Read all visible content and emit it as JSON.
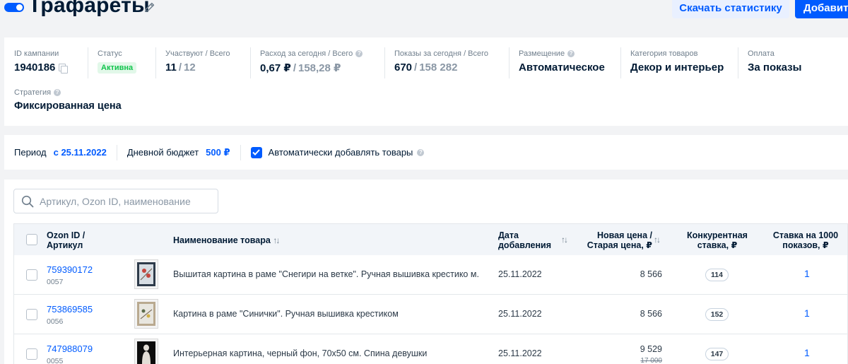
{
  "header": {
    "title": "Трафареты",
    "download_stats_label": "Скачать статистику",
    "add_label": "Добавить"
  },
  "info": {
    "campaign_id_label": "ID кампании",
    "campaign_id": "1940186",
    "status_label": "Статус",
    "status_value": "Активна",
    "participants_label": "Участвуют / Всего",
    "participants_now": "11",
    "participants_total": "12",
    "spend_label": "Расход за сегодня / Всего",
    "spend_today": "0,67 ₽",
    "spend_total": "158,28 ₽",
    "views_label": "Показы за сегодня / Всего",
    "views_today": "670",
    "views_total": "158 282",
    "placement_label": "Размещение",
    "placement_value": "Автоматическое",
    "category_label": "Категория товаров",
    "category_value": "Декор и интерьер",
    "payment_label": "Оплата",
    "payment_value": "За показы",
    "strategy_label": "Стратегия",
    "strategy_value": "Фиксированная цена",
    "separator": "/"
  },
  "period": {
    "period_label": "Период",
    "period_value": "с 25.11.2022",
    "budget_label": "Дневной бюджет",
    "budget_value": "500 ₽",
    "auto_add_label": "Автоматически добавлять товары"
  },
  "search": {
    "placeholder": "Артикул, Ozon ID, наименование"
  },
  "table": {
    "col_id_line1": "Ozon ID /",
    "col_id_line2": "Артикул",
    "col_name": "Наименование товара",
    "col_date_line1": "Дата",
    "col_date_line2": "добавления",
    "col_price_line1": "Новая цена /",
    "col_price_line2": "Старая цена, ₽",
    "col_comp_line1": "Конкурентная",
    "col_comp_line2": "ставка, ₽",
    "col_bid_line1": "Ставка на 1000",
    "col_bid_line2": "показов, ₽",
    "rows": [
      {
        "ozon_id": "759390172",
        "article": "0057",
        "name": "Вышитая картина в раме \"Снегири на ветке\". Ручная вышивка крестико м.",
        "date": "25.11.2022",
        "price": "8 566",
        "old_price": "",
        "competitive": "114",
        "bid": "1"
      },
      {
        "ozon_id": "753869585",
        "article": "0056",
        "name": "Картина в раме \"Синички\". Ручная вышивка крестиком",
        "date": "25.11.2022",
        "price": "8 566",
        "old_price": "",
        "competitive": "152",
        "bid": "1"
      },
      {
        "ozon_id": "747988079",
        "article": "0055",
        "name": "Интерьерная картина, черный фон, 70х50 см. Спина девушки",
        "date": "25.11.2022",
        "price": "9 529",
        "old_price": "17 000",
        "competitive": "147",
        "bid": "1"
      }
    ]
  }
}
